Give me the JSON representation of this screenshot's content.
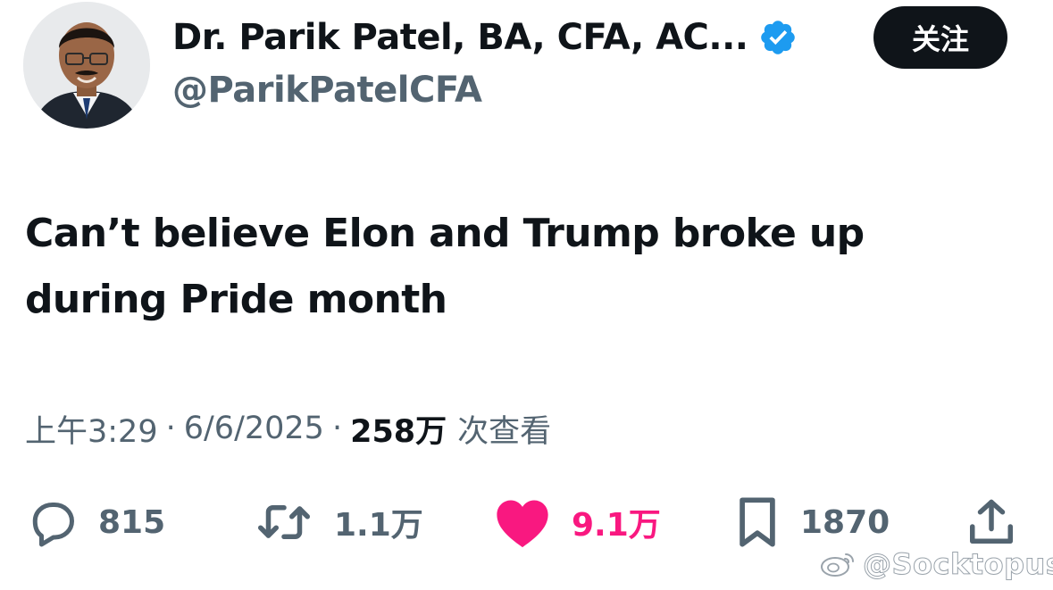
{
  "author": {
    "display_name": "Dr. Parik Patel, BA, CFA, AC...",
    "handle": "@ParikPatelCFA",
    "verified": true
  },
  "follow_button": {
    "label": "关注"
  },
  "tweet": {
    "line1": "Can’t believe Elon and Trump broke up",
    "line2": "during Pride month"
  },
  "meta": {
    "time": "上午3:29",
    "date": "6/6/2025",
    "views": "258万",
    "views_label": "次查看",
    "separator": "·"
  },
  "actions": {
    "replies": "815",
    "reposts": "1.1万",
    "likes": "9.1万",
    "bookmarks": "1870"
  },
  "watermark": {
    "text": "@Socktopus_"
  },
  "colors": {
    "text_primary": "#0f1419",
    "text_secondary": "#536471",
    "like": "#f91880",
    "verified": "#1d9bf0",
    "button_bg": "#0f1419"
  }
}
